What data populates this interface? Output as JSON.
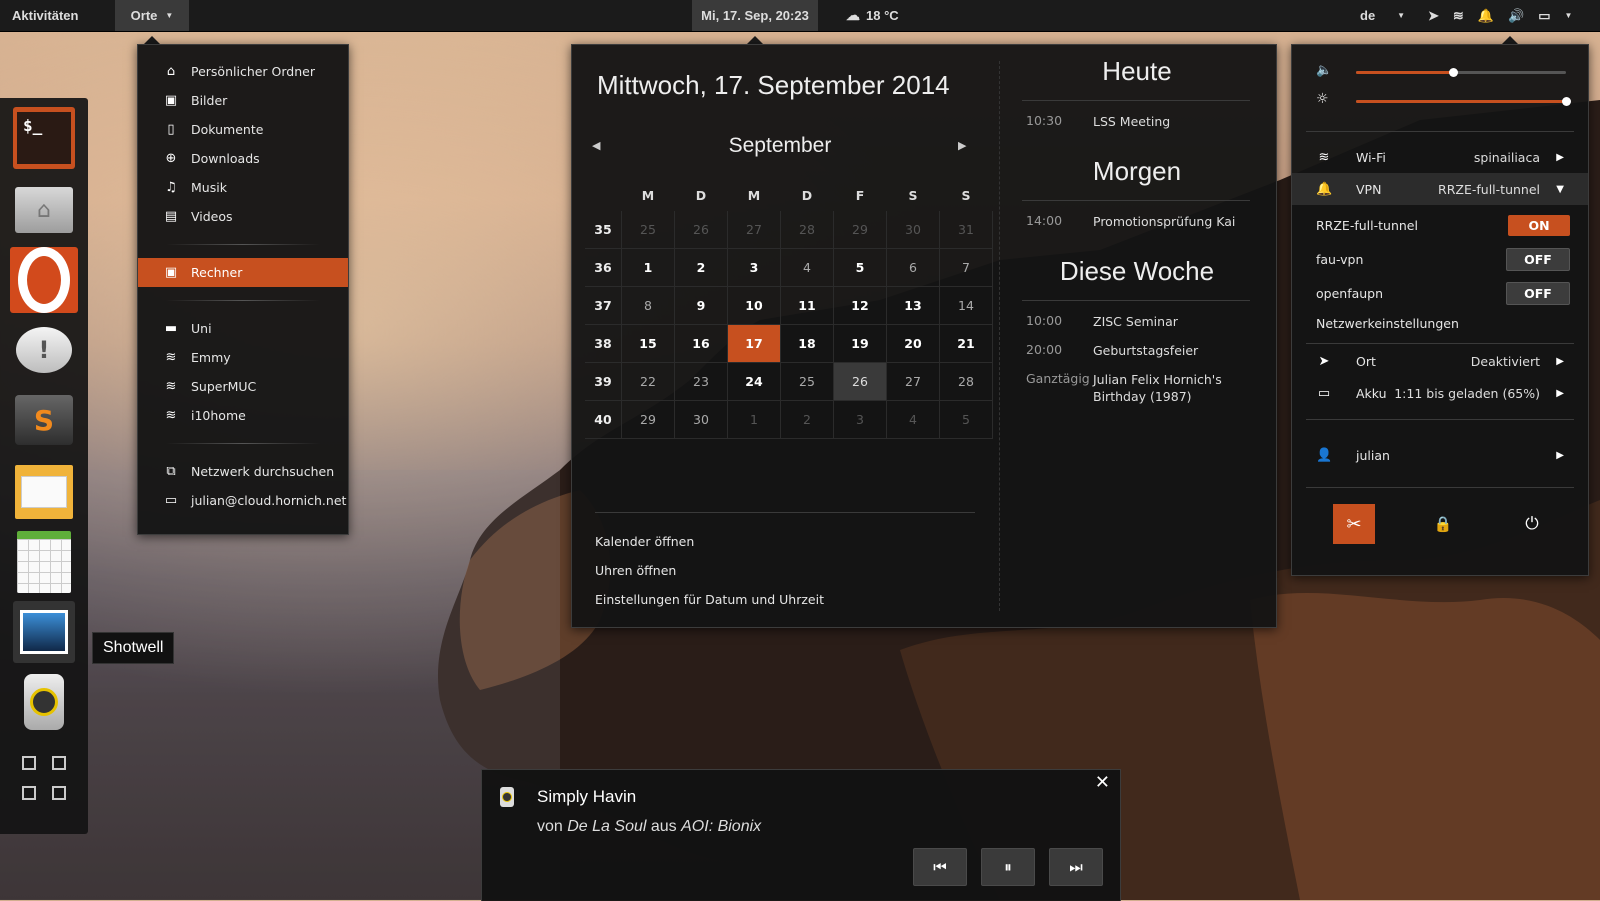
{
  "topbar": {
    "activities": "Aktivitäten",
    "places_menu": "Orte",
    "clock": "Mi, 17. Sep, 20:23",
    "weather": "18 °C",
    "keyboard": "de"
  },
  "places": {
    "items": [
      {
        "label": "Persönlicher Ordner",
        "icon": "home-icon"
      },
      {
        "label": "Bilder",
        "icon": "pictures-icon"
      },
      {
        "label": "Dokumente",
        "icon": "document-icon"
      },
      {
        "label": "Downloads",
        "icon": "download-icon"
      },
      {
        "label": "Musik",
        "icon": "music-icon"
      },
      {
        "label": "Videos",
        "icon": "video-icon"
      }
    ],
    "computer": "Rechner",
    "bookmarks": [
      {
        "label": "Uni",
        "icon": "folder-icon"
      },
      {
        "label": "Emmy",
        "icon": "wifi-icon"
      },
      {
        "label": "SuperMUC",
        "icon": "wifi-icon"
      },
      {
        "label": "i10home",
        "icon": "wifi-icon"
      }
    ],
    "network": [
      {
        "label": "Netzwerk durchsuchen",
        "icon": "network-icon"
      },
      {
        "label": "julian@cloud.hornich.net",
        "icon": "remote-computer-icon"
      }
    ]
  },
  "calendar": {
    "date_heading": "Mittwoch, 17. September 2014",
    "month": "September",
    "weekdays": [
      "M",
      "D",
      "M",
      "D",
      "F",
      "S",
      "S"
    ],
    "weeks": [
      {
        "wk": "35",
        "days": [
          {
            "d": "25",
            "t": "other"
          },
          {
            "d": "26",
            "t": "other"
          },
          {
            "d": "27",
            "t": "other"
          },
          {
            "d": "28",
            "t": "other"
          },
          {
            "d": "29",
            "t": "other"
          },
          {
            "d": "30",
            "t": "other"
          },
          {
            "d": "31",
            "t": "other"
          }
        ]
      },
      {
        "wk": "36",
        "days": [
          {
            "d": "1",
            "t": "bold"
          },
          {
            "d": "2",
            "t": "bold"
          },
          {
            "d": "3",
            "t": "bold"
          },
          {
            "d": "4",
            "t": "norm"
          },
          {
            "d": "5",
            "t": "bold"
          },
          {
            "d": "6",
            "t": "norm"
          },
          {
            "d": "7",
            "t": "norm"
          }
        ]
      },
      {
        "wk": "37",
        "days": [
          {
            "d": "8",
            "t": "norm"
          },
          {
            "d": "9",
            "t": "bold"
          },
          {
            "d": "10",
            "t": "bold"
          },
          {
            "d": "11",
            "t": "bold"
          },
          {
            "d": "12",
            "t": "bold"
          },
          {
            "d": "13",
            "t": "bold"
          },
          {
            "d": "14",
            "t": "norm"
          }
        ]
      },
      {
        "wk": "38",
        "days": [
          {
            "d": "15",
            "t": "bold"
          },
          {
            "d": "16",
            "t": "bold"
          },
          {
            "d": "17",
            "t": "today"
          },
          {
            "d": "18",
            "t": "bold"
          },
          {
            "d": "19",
            "t": "bold"
          },
          {
            "d": "20",
            "t": "bold"
          },
          {
            "d": "21",
            "t": "bold"
          }
        ]
      },
      {
        "wk": "39",
        "days": [
          {
            "d": "22",
            "t": "norm"
          },
          {
            "d": "23",
            "t": "norm"
          },
          {
            "d": "24",
            "t": "bold"
          },
          {
            "d": "25",
            "t": "norm"
          },
          {
            "d": "26",
            "t": "sel"
          },
          {
            "d": "27",
            "t": "norm"
          },
          {
            "d": "28",
            "t": "norm"
          }
        ]
      },
      {
        "wk": "40",
        "days": [
          {
            "d": "29",
            "t": "norm"
          },
          {
            "d": "30",
            "t": "norm"
          },
          {
            "d": "1",
            "t": "other"
          },
          {
            "d": "2",
            "t": "other"
          },
          {
            "d": "3",
            "t": "other"
          },
          {
            "d": "4",
            "t": "other"
          },
          {
            "d": "5",
            "t": "other"
          }
        ]
      }
    ],
    "links": [
      "Kalender öffnen",
      "Uhren öffnen",
      "Einstellungen für Datum und Uhrzeit"
    ],
    "today_heading": "Heute",
    "today_events": [
      {
        "time": "10:30",
        "title": "LSS Meeting"
      }
    ],
    "tomorrow_heading": "Morgen",
    "tomorrow_events": [
      {
        "time": "14:00",
        "title": "Promotionsprüfung Kai"
      }
    ],
    "week_heading": "Diese Woche",
    "week_events": [
      {
        "time": "10:00",
        "title": "ZISC Seminar"
      },
      {
        "time": "20:00",
        "title": "Geburtstagsfeier"
      },
      {
        "time": "Ganztägig",
        "title": "Julian Felix Hornich's Birthday (1987)"
      }
    ]
  },
  "system": {
    "volume_level": 0.46,
    "brightness_level": 1.0,
    "wifi_label": "Wi-Fi",
    "wifi_value": "spinailiaca",
    "vpn_label": "VPN",
    "vpn_value": "RRZE-full-tunnel",
    "vpn_connections": [
      {
        "name": "RRZE-full-tunnel",
        "state": "ON"
      },
      {
        "name": "fau-vpn",
        "state": "OFF"
      },
      {
        "name": "openfaupn",
        "state": "OFF"
      }
    ],
    "network_settings": "Netzwerkeinstellungen",
    "location_label": "Ort",
    "location_value": "Deaktiviert",
    "battery_label": "Akku",
    "battery_value": "1:11 bis geladen (65%)",
    "user": "julian"
  },
  "dock": {
    "tooltip": "Shotwell",
    "apps": [
      "terminal",
      "files",
      "opera",
      "empathy",
      "sublime-text",
      "mail",
      "calendar",
      "shotwell",
      "rhythmbox",
      "show-apps"
    ]
  },
  "notification": {
    "title": "Simply Havin",
    "by": "von",
    "artist": "De La Soul",
    "from": "aus",
    "album": "AOI: Bionix"
  },
  "colors": {
    "accent": "#c7501f",
    "panel": "#141414",
    "topbar": "#1b1b1b"
  }
}
